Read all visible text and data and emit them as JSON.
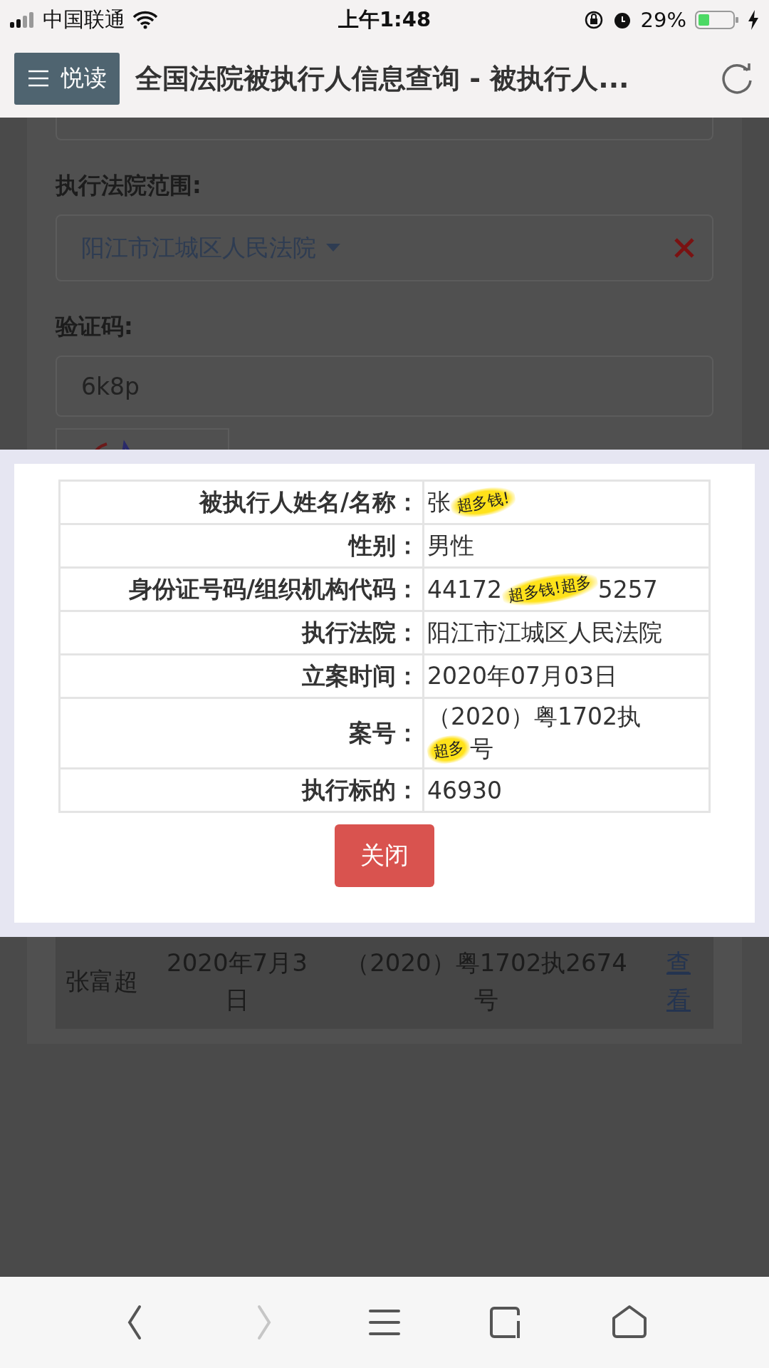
{
  "status_bar": {
    "carrier": "中国联通",
    "time": "上午1:48",
    "battery": "29%"
  },
  "top_bar": {
    "menu_button": "悦读",
    "title": "全国法院被执行人信息查询 - 被执行人..."
  },
  "search_form": {
    "court_label": "执行法院范围:",
    "court_value": "阳江市江城区人民法院",
    "captcha_label": "验证码:",
    "captcha_value": "6k8p"
  },
  "result_row": {
    "cells": [
      "张富超",
      "2020年7月3日",
      "（2020）粤1702执2674号"
    ],
    "link": "查看"
  },
  "dialog": {
    "rows": [
      {
        "label": "被执行人姓名/名称：",
        "value": [
          {
            "kind": "text",
            "text": "张"
          },
          {
            "kind": "sticker",
            "text": "超多钱!"
          }
        ]
      },
      {
        "label": "性别：",
        "value": [
          {
            "kind": "text",
            "text": "男性"
          }
        ]
      },
      {
        "label": "身份证号码/组织机构代码：",
        "value": [
          {
            "kind": "text",
            "text": "44172"
          },
          {
            "kind": "sticker",
            "text": "超多钱!超多"
          },
          {
            "kind": "text",
            "text": "5257"
          }
        ]
      },
      {
        "label": "执行法院：",
        "value": [
          {
            "kind": "text",
            "text": "阳江市江城区人民法院"
          }
        ]
      },
      {
        "label": "立案时间：",
        "value": [
          {
            "kind": "text",
            "text": "2020年07月03日"
          }
        ]
      },
      {
        "label": "案号：",
        "value": [
          {
            "kind": "text",
            "text": "（2020）粤1702执"
          },
          {
            "kind": "break"
          },
          {
            "kind": "sticker",
            "text": "超多"
          },
          {
            "kind": "text",
            "text": "号"
          }
        ]
      },
      {
        "label": "执行标的：",
        "value": [
          {
            "kind": "text",
            "text": "46930"
          }
        ]
      }
    ],
    "close_button": "关闭"
  },
  "browser_toolbar": [
    {
      "kind": "back",
      "disabled": false
    },
    {
      "kind": "forward",
      "disabled": true
    },
    {
      "kind": "menu",
      "disabled": false
    },
    {
      "kind": "tabs",
      "disabled": false
    },
    {
      "kind": "home",
      "disabled": false
    }
  ]
}
